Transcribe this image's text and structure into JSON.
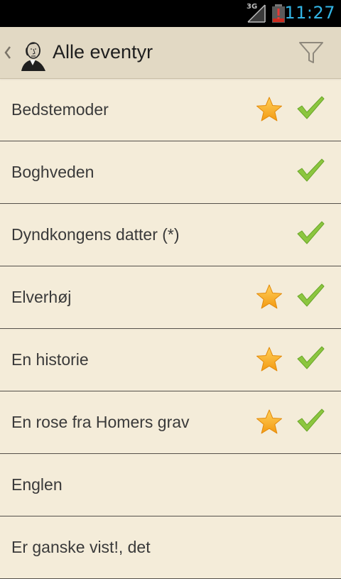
{
  "status_bar": {
    "network": "3G",
    "time": "11:27",
    "icons": [
      "signal-icon",
      "battery-low-icon"
    ]
  },
  "action_bar": {
    "title": "Alle eventyr",
    "icons": [
      "up-chevron-icon",
      "author-portrait-avatar",
      "filter-icon"
    ]
  },
  "list": {
    "items": [
      {
        "title": "Bedstemoder",
        "favorite": true,
        "read": true
      },
      {
        "title": "Boghveden",
        "favorite": false,
        "read": true
      },
      {
        "title": "Dyndkongens datter (*)",
        "favorite": false,
        "read": true
      },
      {
        "title": "Elverhøj",
        "favorite": true,
        "read": true
      },
      {
        "title": "En historie",
        "favorite": true,
        "read": true
      },
      {
        "title": "En rose fra Homers grav",
        "favorite": true,
        "read": true
      },
      {
        "title": "Englen",
        "favorite": false,
        "read": false
      },
      {
        "title": "Er ganske vist!, det",
        "favorite": false,
        "read": false
      }
    ]
  },
  "colors": {
    "status_bar_bg": "#000000",
    "clock": "#33b5e5",
    "action_bar_bg": "#e2d9c4",
    "list_bg": "#f4ecd9",
    "divider": "#54504a",
    "star": "#f7a51c",
    "check": "#8cc63f"
  }
}
